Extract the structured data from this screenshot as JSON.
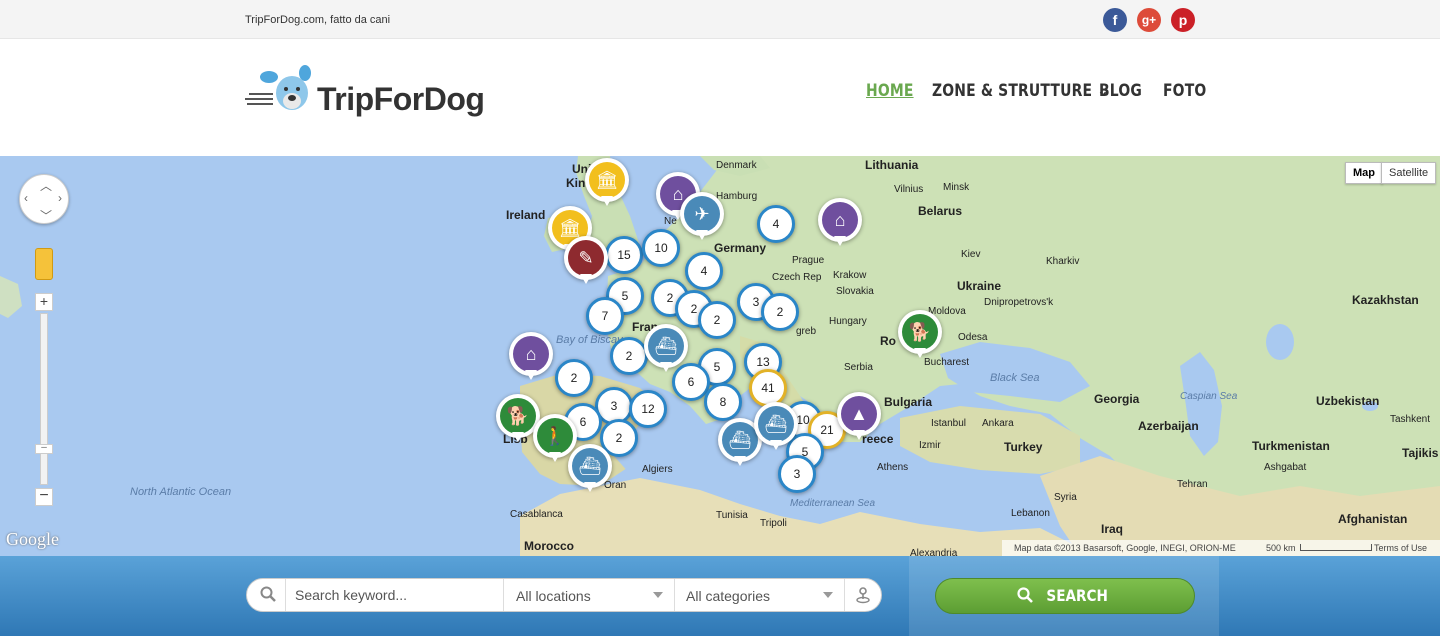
{
  "topbar": {
    "tagline": "TripForDog.com, fatto da cani",
    "social": [
      {
        "name": "facebook-icon",
        "glyph": "f"
      },
      {
        "name": "google-plus-icon",
        "glyph": "g+"
      },
      {
        "name": "pinterest-icon",
        "glyph": "p"
      }
    ]
  },
  "header": {
    "logo_text": "TripForDog",
    "nav": [
      {
        "label": "HOME",
        "active": true
      },
      {
        "label": "ZONE & STRUTTURE",
        "has_dropdown": true
      },
      {
        "label": "BLOG"
      },
      {
        "label": "FOTO"
      }
    ],
    "dropdown_glyph": "⌄"
  },
  "map": {
    "type_buttons": [
      "Map",
      "Satellite"
    ],
    "labels": [
      {
        "t": "Lithuania"
      },
      {
        "t": "Denmark",
        "small": true
      },
      {
        "t": "Hamburg",
        "small": true
      },
      {
        "t": "Vilnius",
        "small": true
      },
      {
        "t": "Minsk",
        "small": true
      },
      {
        "t": "Belarus"
      },
      {
        "t": "Ireland"
      },
      {
        "t": "Germany"
      },
      {
        "t": "Prague",
        "small": true
      },
      {
        "t": "Czech Rep",
        "small": true
      },
      {
        "t": "Krakow",
        "small": true
      },
      {
        "t": "Slovakia",
        "small": true
      },
      {
        "t": "Kiev",
        "small": true
      },
      {
        "t": "Kharkiv",
        "small": true
      },
      {
        "t": "Ukraine"
      },
      {
        "t": "Dnipropetrovs'k",
        "small": true
      },
      {
        "t": "Hungary",
        "small": true
      },
      {
        "t": "Moldova",
        "small": true
      },
      {
        "t": "Odesa",
        "small": true
      },
      {
        "t": "Bucharest",
        "small": true
      },
      {
        "t": "Serbia",
        "small": true
      },
      {
        "t": "Bulgaria"
      },
      {
        "t": "Istanbul",
        "small": true
      },
      {
        "t": "Ankara",
        "small": true
      },
      {
        "t": "Izmir",
        "small": true
      },
      {
        "t": "Turkey"
      },
      {
        "t": "Athens",
        "small": true
      },
      {
        "t": "Georgia"
      },
      {
        "t": "Azerbaijan"
      },
      {
        "t": "Kazakhstan"
      },
      {
        "t": "Uzbekistan"
      },
      {
        "t": "Tashkent",
        "small": true
      },
      {
        "t": "Turkmenistan"
      },
      {
        "t": "Ashgabat",
        "small": true
      },
      {
        "t": "Tajikis"
      },
      {
        "t": "Tehran",
        "small": true
      },
      {
        "t": "Syria",
        "small": true
      },
      {
        "t": "Lebanon",
        "small": true
      },
      {
        "t": "Iraq"
      },
      {
        "t": "Afghanistan"
      },
      {
        "t": "Algiers",
        "small": true
      },
      {
        "t": "Oran",
        "small": true
      },
      {
        "t": "Tunisia",
        "small": true
      },
      {
        "t": "Tripoli",
        "small": true
      },
      {
        "t": "Casablanca",
        "small": true
      },
      {
        "t": "Morocco"
      },
      {
        "t": "Alexandria",
        "small": true
      },
      {
        "t": "Fran"
      },
      {
        "t": "Ro"
      },
      {
        "t": "Lisb"
      },
      {
        "t": "Uni"
      },
      {
        "t": "Kin"
      },
      {
        "t": "Ne"
      },
      {
        "t": "greb",
        "small": true
      },
      {
        "t": "reece"
      }
    ],
    "seas": [
      "Bay of Biscay",
      "Black Sea",
      "Caspian Sea",
      "Mediterranean Sea",
      "North Atlantic Ocean"
    ],
    "clusters": [
      {
        "n": "15"
      },
      {
        "n": "10"
      },
      {
        "n": "4"
      },
      {
        "n": "4"
      },
      {
        "n": "5"
      },
      {
        "n": "2"
      },
      {
        "n": "2"
      },
      {
        "n": "2"
      },
      {
        "n": "3"
      },
      {
        "n": "2"
      },
      {
        "n": "7"
      },
      {
        "n": "2"
      },
      {
        "n": "5"
      },
      {
        "n": "13"
      },
      {
        "n": "6"
      },
      {
        "n": "8"
      },
      {
        "n": "2"
      },
      {
        "n": "41",
        "gold": true
      },
      {
        "n": "3"
      },
      {
        "n": "6"
      },
      {
        "n": "12"
      },
      {
        "n": "2"
      },
      {
        "n": "10"
      },
      {
        "n": "21",
        "gold": true
      },
      {
        "n": "5"
      },
      {
        "n": "3"
      }
    ],
    "pins": [
      {
        "icon": "museum-icon",
        "color": "yellow",
        "glyph": "🏛"
      },
      {
        "icon": "museum-icon",
        "color": "yellow",
        "glyph": "🏛"
      },
      {
        "icon": "hotel-icon",
        "color": "purple",
        "glyph": "⌂"
      },
      {
        "icon": "airport-icon",
        "color": "blue",
        "glyph": "✈"
      },
      {
        "icon": "hotel-icon",
        "color": "purple",
        "glyph": "⌂"
      },
      {
        "icon": "document-icon",
        "color": "red",
        "glyph": "✎"
      },
      {
        "icon": "hotel-icon",
        "color": "purple",
        "glyph": "⌂"
      },
      {
        "icon": "ferry-icon",
        "color": "blue",
        "glyph": "⛴"
      },
      {
        "icon": "dog-icon",
        "color": "green",
        "glyph": "🐕"
      },
      {
        "icon": "dog-icon",
        "color": "green",
        "glyph": "🐕"
      },
      {
        "icon": "dog-walking-icon",
        "color": "green",
        "glyph": "🚶"
      },
      {
        "icon": "ferry-icon",
        "color": "blue",
        "glyph": "⛴"
      },
      {
        "icon": "ferry-icon",
        "color": "blue",
        "glyph": "⛴"
      },
      {
        "icon": "ferry-icon",
        "color": "blue",
        "glyph": "⛴"
      },
      {
        "icon": "camping-icon",
        "color": "purple",
        "glyph": "▲"
      }
    ],
    "google_logo": "Google",
    "attribution": "Map data ©2013 Basarsoft, Google, INEGI, ORION-ME",
    "scale": "500 km",
    "terms": "Terms of Use"
  },
  "search": {
    "keyword_placeholder": "Search keyword...",
    "locations_value": "All locations",
    "categories_value": "All categories",
    "button_label": "SEARCH"
  },
  "colors": {
    "accent_green": "#6aa84f",
    "cluster_blue": "#2a86c8",
    "band_blue": "#2f78b5"
  }
}
